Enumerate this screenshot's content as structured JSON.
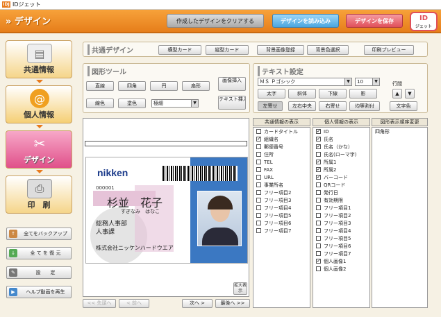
{
  "window": {
    "title": "IDジェット"
  },
  "header": {
    "title": "デザイン",
    "clear_btn": "作成したデザインをクリアする",
    "load_btn": "デザインを読み込み",
    "save_btn": "デザインを保存",
    "logo_main": "ID",
    "logo_sub": "ジェット"
  },
  "sidebar": {
    "nav": [
      {
        "label": "共通情報"
      },
      {
        "label": "個人情報"
      },
      {
        "label": "デザイン"
      },
      {
        "label": "印　刷"
      }
    ],
    "buttons": [
      {
        "label": "全てをバックアップ"
      },
      {
        "label": "全 て を 復 元"
      },
      {
        "label": "設　　定"
      },
      {
        "label": "ヘルプ動画を再生"
      }
    ]
  },
  "common_design": {
    "title": "共通デザイン",
    "buttons": [
      "横型カード",
      "縦型カード",
      "背景画像登録",
      "背景色選択",
      "印刷プレビュー"
    ]
  },
  "shape_tools": {
    "title": "図形ツール",
    "row1": [
      "直線",
      "四角",
      "円",
      "扇形",
      "画像挿入"
    ],
    "row2": [
      "線色",
      "塗色"
    ],
    "line_style": "極細",
    "text_insert": "テキスト挿入"
  },
  "text_settings": {
    "title": "テキスト設定",
    "font": "ＭＳ Ｐゴシック",
    "size": "10",
    "line_spacing_label": "行間",
    "row1": [
      "太字",
      "斜体",
      "下線",
      "影"
    ],
    "row2": [
      "左寄せ",
      "左右中央",
      "右寄せ",
      "均等割付"
    ],
    "text_color": "文字色"
  },
  "card": {
    "brand": "nikken",
    "number": "000001",
    "name": "杉並　花子",
    "kana": "すぎなみ　はなこ",
    "dept1": "総務人事部",
    "dept2": "人事課",
    "company": "株式会社ニッケンハードウエア"
  },
  "common_info": {
    "header": "共通情報の表示",
    "items": [
      {
        "label": "カードタイトル",
        "checked": false
      },
      {
        "label": "組織名",
        "checked": true
      },
      {
        "label": "郵便番号",
        "checked": false
      },
      {
        "label": "住所",
        "checked": false
      },
      {
        "label": "TEL",
        "checked": false
      },
      {
        "label": "FAX",
        "checked": false
      },
      {
        "label": "URL",
        "checked": false
      },
      {
        "label": "事業所名",
        "checked": false
      },
      {
        "label": "フリー項目2",
        "checked": false
      },
      {
        "label": "フリー項目3",
        "checked": false
      },
      {
        "label": "フリー項目4",
        "checked": false
      },
      {
        "label": "フリー項目5",
        "checked": false
      },
      {
        "label": "フリー項目6",
        "checked": false
      },
      {
        "label": "フリー項目7",
        "checked": false
      }
    ]
  },
  "personal_info": {
    "header": "個人情報の表示",
    "items": [
      {
        "label": "ID",
        "checked": true
      },
      {
        "label": "氏名",
        "checked": true
      },
      {
        "label": "氏名（かな）",
        "checked": true
      },
      {
        "label": "氏名(ローマ字)",
        "checked": false
      },
      {
        "label": "所属1",
        "checked": true
      },
      {
        "label": "所属2",
        "checked": true
      },
      {
        "label": "バーコード",
        "checked": true
      },
      {
        "label": "QRコード",
        "checked": false
      },
      {
        "label": "発行日",
        "checked": false
      },
      {
        "label": "有効期限",
        "checked": false
      },
      {
        "label": "フリー項目1",
        "checked": false
      },
      {
        "label": "フリー項目2",
        "checked": false
      },
      {
        "label": "フリー項目3",
        "checked": false
      },
      {
        "label": "フリー項目4",
        "checked": false
      },
      {
        "label": "フリー項目5",
        "checked": false
      },
      {
        "label": "フリー項目6",
        "checked": false
      },
      {
        "label": "フリー項目7",
        "checked": false
      },
      {
        "label": "個人画像1",
        "checked": true
      },
      {
        "label": "個人画像2",
        "checked": false
      }
    ]
  },
  "shape_order": {
    "header": "図形表示順序変更",
    "items": [
      "四角形"
    ]
  },
  "pager": {
    "first": "<< 先頭へ",
    "prev": "< 前へ",
    "next": "次へ >",
    "last": "最後へ >>",
    "zoom": "拡大表示"
  }
}
